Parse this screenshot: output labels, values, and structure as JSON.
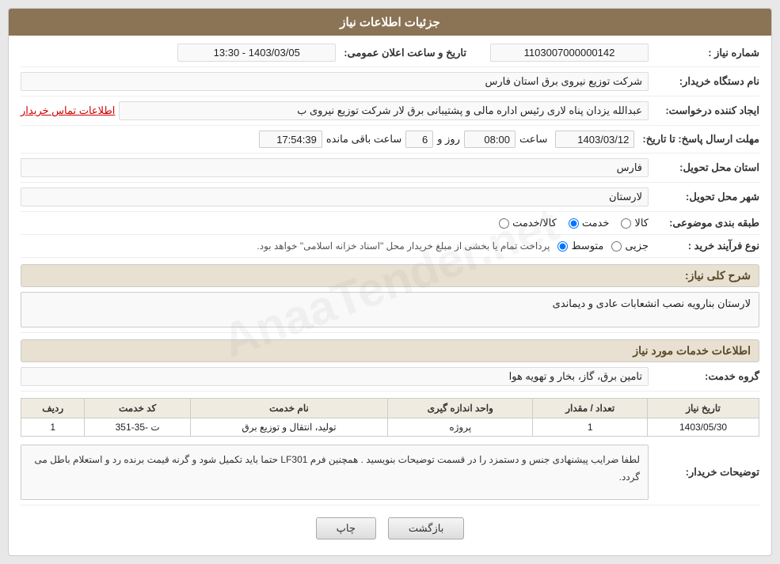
{
  "page": {
    "title": "جزئیات اطلاعات نیاز",
    "watermark": "AnaaTender.net"
  },
  "fields": {
    "shomara_niaz_label": "شماره نیاز :",
    "shomara_niaz_value": "1103007000000142",
    "nam_dastgah_label": "نام دستگاه خریدار:",
    "nam_dastgah_value": "شرکت توزیع نیروی برق استان فارس",
    "ijad_konande_label": "ایجاد کننده درخواست:",
    "ijad_konande_value": "عبدالله یزدان پناه لاری رئیس اداره مالی و پشتیبانی برق لار شرکت توزیع نیروی ب",
    "ejad_link": "اطلاعات تماس خریدار",
    "mohlet_label": "مهلت ارسال پاسخ: تا تاریخ:",
    "mohlet_date": "1403/03/12",
    "mohlet_saat_label": "ساعت",
    "mohlet_saat": "08:00",
    "mohlet_rooz_label": "روز و",
    "mohlet_rooz": "6",
    "mohlet_mande_label": "ساعت باقی مانده",
    "mohlet_mande": "17:54:39",
    "ostan_label": "استان محل تحویل:",
    "ostan_value": "فارس",
    "shahr_label": "شهر محل تحویل:",
    "shahr_value": "لارستان",
    "tabaqe_label": "طبقه بندی موضوعی:",
    "tabaqe_kala": "کالا",
    "tabaqe_khadamat": "خدمت",
    "tabaqe_kala_khadamat": "کالا/خدمت",
    "tabaqe_selected": "khadamat",
    "nooe_label": "نوع فرآیند خرید :",
    "nooe_jazii": "جزیی",
    "nooe_motevaset": "متوسط",
    "nooe_notice": "پرداخت تمام یا بخشی از مبلغ خریدار محل \"اسناد خزانه اسلامی\" خواهد بود.",
    "nooe_selected": "motevaset",
    "tarikh_elan_label": "تاریخ و ساعت اعلان عمومی:",
    "tarikh_elan_value": "1403/03/05 - 13:30",
    "sharh_label": "شرح کلی نیاز:",
    "sharh_value": "لارستان بنارویه نصب انشعابات عادی و دیماندی",
    "khadamat_label": "اطلاعات خدمات مورد نیاز",
    "gorooh_label": "گروه خدمت:",
    "gorooh_value": "تامین برق، گاز، بخار و تهویه هوا",
    "table": {
      "headers": [
        "ردیف",
        "کد خدمت",
        "نام خدمت",
        "واحد اندازه گیری",
        "تعداد / مقدار",
        "تاریخ نیاز"
      ],
      "rows": [
        {
          "radif": "1",
          "kod": "ت -35-351",
          "nam": "تولید، انتقال و توزیع برق",
          "vahed": "پروژه",
          "tedad": "1",
          "tarikh": "1403/05/30"
        }
      ]
    },
    "tosihat_label": "توضیحات خریدار:",
    "tosihat_value": "لطفا ضرایب پیشنهادی جنس و دستمزد را در قسمت توضیحات بنویسید . همچنین فرم LF301 حتما باید تکمیل شود و گرنه قیمت برنده رد و استعلام باطل می گردد.",
    "btn_back": "بازگشت",
    "btn_print": "چاپ"
  }
}
